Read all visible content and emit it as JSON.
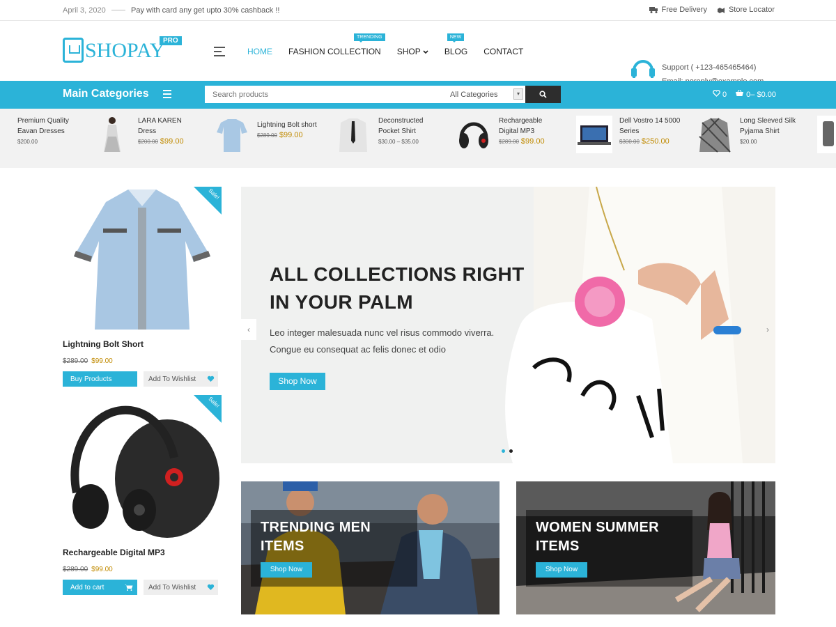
{
  "topbar": {
    "date": "April 3, 2020",
    "promo": "Pay with card any get upto 30% cashback !!",
    "free_delivery": "Free Delivery",
    "store_locator": "Store Locator"
  },
  "header": {
    "logo_text": "SHOPAY",
    "logo_badge": "PRO",
    "nav": [
      {
        "label": "HOME",
        "badge": ""
      },
      {
        "label": "FASHION COLLECTION",
        "badge": "TRENDING"
      },
      {
        "label": "SHOP",
        "badge": ""
      },
      {
        "label": "BLOG",
        "badge": "NEW"
      },
      {
        "label": "CONTACT",
        "badge": ""
      }
    ],
    "support": "Support ( +123-465465464)",
    "email": "Email: noreply@example.com"
  },
  "catbar": {
    "title": "Main Categories",
    "search_placeholder": "Search products",
    "category_select": "All Categories",
    "wishlist_count": "0",
    "cart_count": "0",
    "cart_total": "$0.00"
  },
  "strip": [
    {
      "name": "Premium Quality Eavan Dresses",
      "old": "",
      "price": "",
      "range": "$200.00"
    },
    {
      "name": "LARA KAREN Dress",
      "old": "$200.00",
      "price": "$99.00",
      "range": ""
    },
    {
      "name": "Lightning Bolt short",
      "old": "$289.00",
      "price": "$99.00",
      "range": ""
    },
    {
      "name": "Deconstructed Pocket Shirt",
      "old": "",
      "price": "",
      "range": "$30.00 – $35.00"
    },
    {
      "name": "Rechargeable Digital MP3",
      "old": "$289.00",
      "price": "$99.00",
      "range": ""
    },
    {
      "name": "Dell Vostro 14 5000 Series",
      "old": "$300.00",
      "price": "$250.00",
      "range": ""
    },
    {
      "name": "Long Sleeved Silk Pyjama Shirt",
      "old": "",
      "price": "",
      "range": "$20.00"
    }
  ],
  "products": [
    {
      "name": "Lightning Bolt Short",
      "old": "$289.00",
      "price": "$99.00",
      "primary": "Buy Products",
      "secondary": "Add To Wishlist",
      "sale": "Sale!"
    },
    {
      "name": "Rechargeable Digital MP3",
      "old": "$289.00",
      "price": "$99.00",
      "primary": "Add to cart",
      "secondary": "Add To Wishlist",
      "sale": "Sale!"
    }
  ],
  "hero": {
    "title_line1": "ALL COLLECTIONS RIGHT",
    "title_line2": "IN YOUR PALM",
    "text_line1": "Leo integer malesuada nunc vel risus commodo viverra.",
    "text_line2": "Congue eu consequat ac felis donec et odio",
    "button": "Shop Now"
  },
  "banners": [
    {
      "line1": "TRENDING MEN",
      "line2": "ITEMS",
      "button": "Shop Now"
    },
    {
      "line1": "WOMEN SUMMER",
      "line2": "ITEMS",
      "button": "Shop Now"
    }
  ],
  "colors": {
    "accent": "#2bb3d8",
    "price": "#c08a00",
    "dark": "#2d2d2d"
  }
}
